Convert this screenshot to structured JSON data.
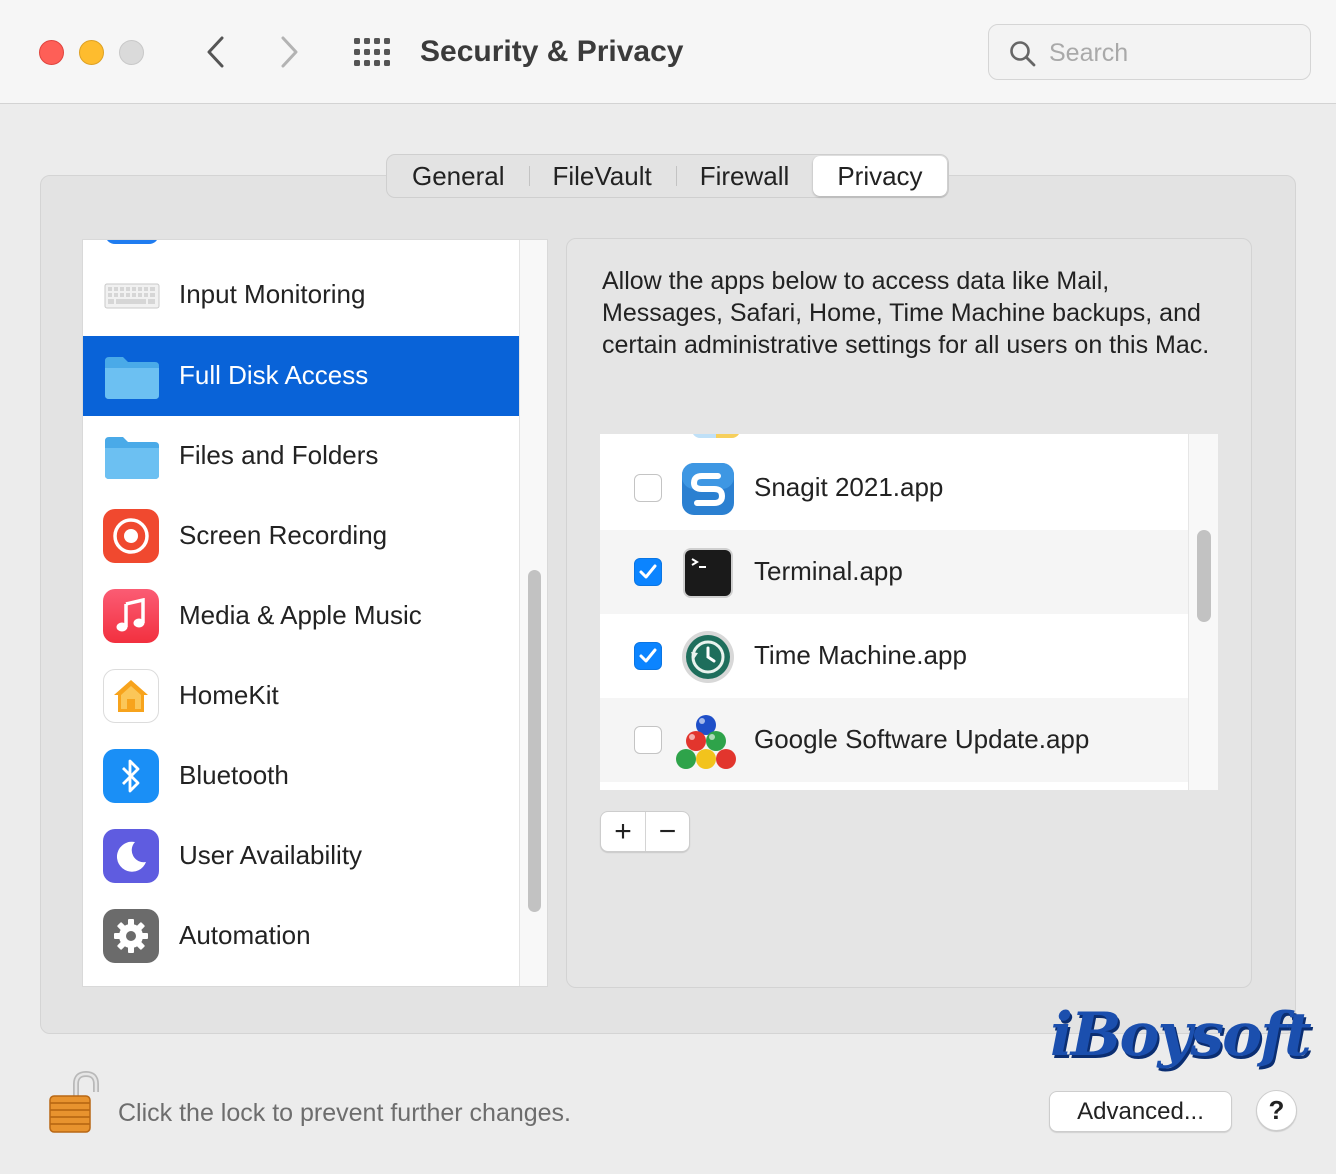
{
  "window": {
    "title": "Security & Privacy",
    "search_placeholder": "Search"
  },
  "tabs": [
    {
      "label": "General"
    },
    {
      "label": "FileVault"
    },
    {
      "label": "Firewall"
    },
    {
      "label": "Privacy",
      "active": true
    }
  ],
  "sidebar": {
    "items": [
      {
        "label": "Input Monitoring",
        "icon": "keyboard-icon"
      },
      {
        "label": "Full Disk Access",
        "icon": "folder-icon",
        "selected": true
      },
      {
        "label": "Files and Folders",
        "icon": "folder-icon"
      },
      {
        "label": "Screen Recording",
        "icon": "screen-recording-icon"
      },
      {
        "label": "Media & Apple Music",
        "icon": "music-icon"
      },
      {
        "label": "HomeKit",
        "icon": "home-icon"
      },
      {
        "label": "Bluetooth",
        "icon": "bluetooth-icon"
      },
      {
        "label": "User Availability",
        "icon": "moon-icon"
      },
      {
        "label": "Automation",
        "icon": "gear-icon"
      }
    ]
  },
  "description": "Allow the apps below to access data like Mail, Messages, Safari, Home, Time Machine backups, and certain administrative settings for all users on this Mac.",
  "apps": [
    {
      "name": "Snagit 2021.app",
      "checked": false,
      "icon": "snagit-icon"
    },
    {
      "name": "Terminal.app",
      "checked": true,
      "icon": "terminal-icon"
    },
    {
      "name": "Time Machine.app",
      "checked": true,
      "icon": "time-machine-icon"
    },
    {
      "name": "Google Software Update.app",
      "checked": false,
      "icon": "google-update-icon"
    }
  ],
  "controls": {
    "add_label": "+",
    "remove_label": "−"
  },
  "footer": {
    "lock_text": "Click the lock to prevent further changes.",
    "advanced_label": "Advanced...",
    "help_label": "?"
  },
  "watermark": "iBoysoft",
  "colors": {
    "selection": "#0963d8",
    "checkbox_on": "#0b84ff",
    "close": "#fe5f57",
    "minimize": "#febc2e"
  }
}
